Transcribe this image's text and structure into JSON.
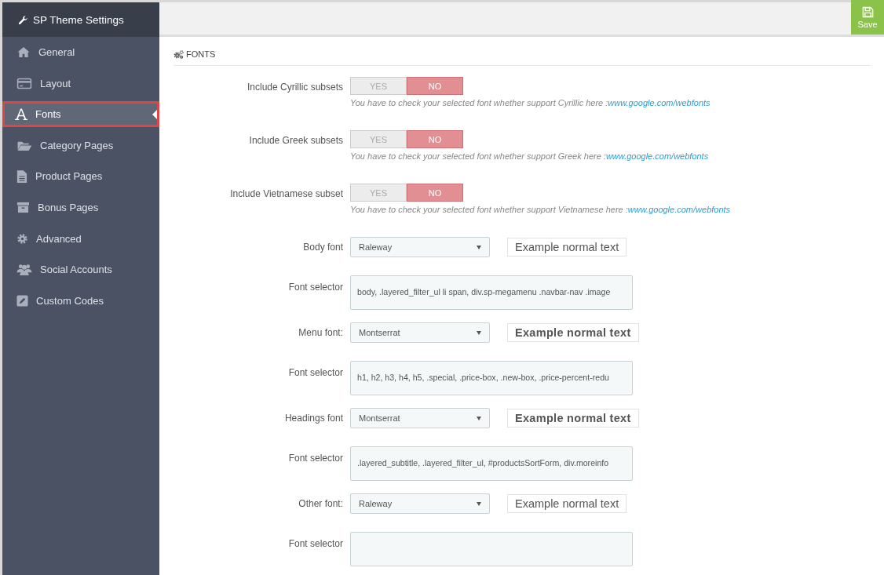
{
  "sidebar": {
    "title": "SP Theme Settings",
    "items": [
      {
        "label": "General",
        "selected": false
      },
      {
        "label": "Layout",
        "selected": false
      },
      {
        "label": "Fonts",
        "selected": true
      },
      {
        "label": "Category Pages",
        "selected": false
      },
      {
        "label": "Product Pages",
        "selected": false
      },
      {
        "label": "Bonus Pages",
        "selected": false
      },
      {
        "label": "Advanced",
        "selected": false
      },
      {
        "label": "Social Accounts",
        "selected": false
      },
      {
        "label": "Custom Codes",
        "selected": false
      }
    ]
  },
  "save_button": {
    "label": "Save"
  },
  "section": {
    "title": "FONTS"
  },
  "fields": [
    {
      "kind": "toggle",
      "label": "Include Cyrillic subsets",
      "options": [
        {
          "label": "YES",
          "selected": false
        },
        {
          "label": "NO",
          "selected": true
        }
      ],
      "help": "You have to check your selected font whether support Cyrillic here :",
      "link": "www.google.com/webfonts"
    },
    {
      "kind": "toggle",
      "label": "Include Greek subsets",
      "options": [
        {
          "label": "YES",
          "selected": false
        },
        {
          "label": "NO",
          "selected": true
        }
      ],
      "help": "You have to check your selected font whether support Greek here :",
      "link": "www.google.com/webfonts"
    },
    {
      "kind": "toggle",
      "label": "Include Vietnamese subset",
      "options": [
        {
          "label": "YES",
          "selected": false
        },
        {
          "label": "NO",
          "selected": true
        }
      ],
      "help": "You have to check your selected font whether support Vietnamese here :",
      "link": "www.google.com/webfonts"
    },
    {
      "kind": "select",
      "label": "Body font",
      "value": "Raleway",
      "example": "Example normal text",
      "example_bold": false
    },
    {
      "kind": "selector",
      "label": "Font selector",
      "value": "body, .layered_filter_ul li span, div.sp-megamenu .navbar-nav .image"
    },
    {
      "kind": "select",
      "label": "Menu font:",
      "value": "Montserrat",
      "example": "Example normal text",
      "example_bold": true
    },
    {
      "kind": "selector",
      "label": "Font selector",
      "value": "h1, h2, h3, h4, h5, .special, .price-box, .new-box, .price-percent-redu"
    },
    {
      "kind": "select",
      "label": "Headings font",
      "value": "Montserrat",
      "example": "Example normal text",
      "example_bold": true
    },
    {
      "kind": "selector",
      "label": "Font selector",
      "value": ".layered_subtitle, .layered_filter_ul, #productsSortForm, div.moreinfo"
    },
    {
      "kind": "select",
      "label": "Other font:",
      "value": "Raleway",
      "example": "Example normal text",
      "example_bold": false
    },
    {
      "kind": "selector",
      "label": "Font selector"
    }
  ]
}
